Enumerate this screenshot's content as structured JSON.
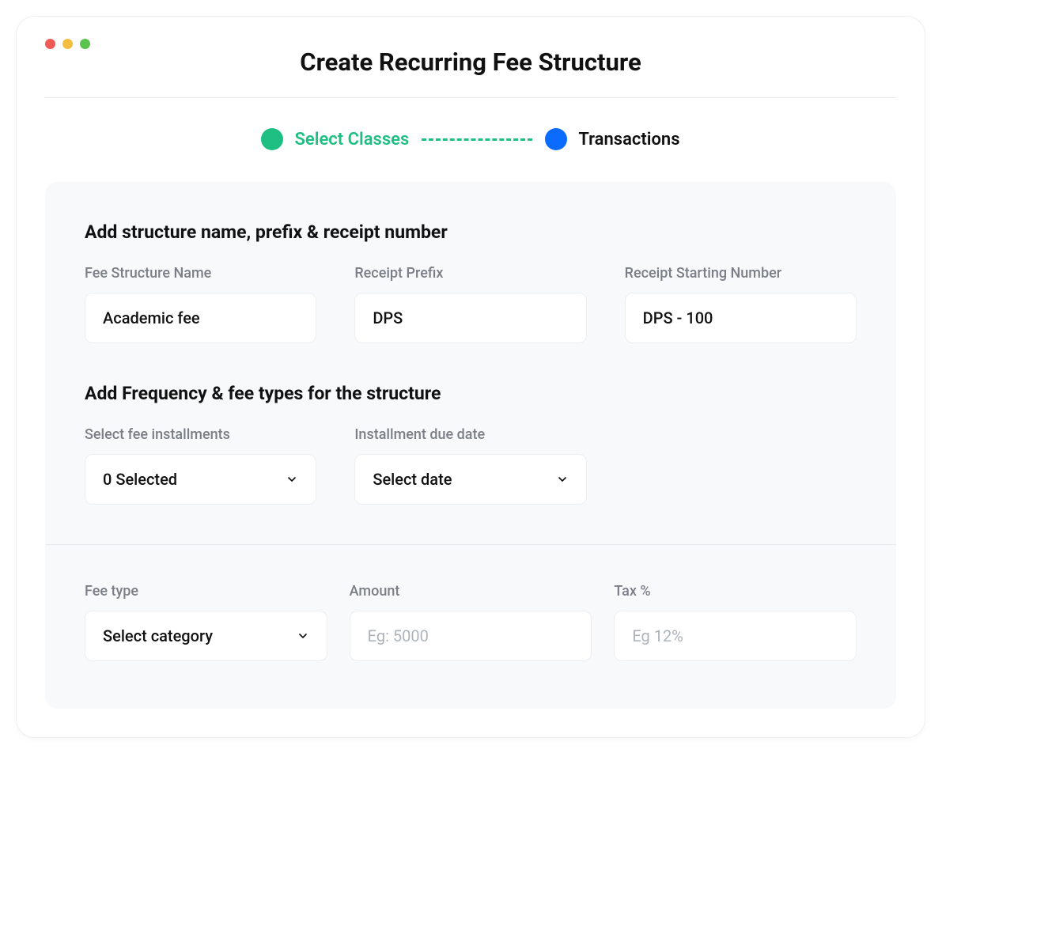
{
  "page": {
    "title": "Create Recurring Fee Structure"
  },
  "stepper": {
    "step1_label": "Select Classes",
    "step2_label": "Transactions"
  },
  "section1": {
    "heading": "Add structure name, prefix & receipt number",
    "fee_name_label": "Fee Structure Name",
    "fee_name_value": "Academic fee",
    "prefix_label": "Receipt Prefix",
    "prefix_value": "DPS",
    "start_num_label": "Receipt Starting Number",
    "start_num_value": "DPS - 100"
  },
  "section2": {
    "heading": "Add Frequency & fee types for the structure",
    "installments_label": "Select fee installments",
    "installments_value": "0 Selected",
    "due_date_label": "Installment due date",
    "due_date_value": "Select date"
  },
  "section3": {
    "fee_type_label": "Fee type",
    "fee_type_value": "Select category",
    "amount_label": "Amount",
    "amount_placeholder": "Eg: 5000",
    "tax_label": "Tax %",
    "tax_placeholder": "Eg 12%"
  }
}
